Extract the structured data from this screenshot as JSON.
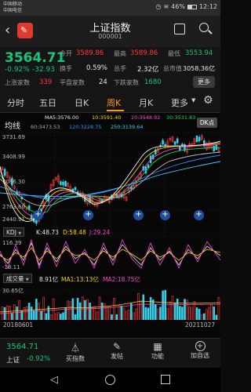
{
  "status_bar": {
    "carrier1": "中国移动",
    "carrier2": "中国电信",
    "battery": "46%",
    "time": "12:12"
  },
  "header": {
    "title": "上证指数",
    "code": "000001"
  },
  "quote": {
    "price": "3564.71",
    "change": "-0.92%",
    "change_amt": "-32.93",
    "open_label": "今开",
    "open": "3589.86",
    "high_label": "最高",
    "high": "3589.86",
    "low_label": "最低",
    "low": "3553.94",
    "turnover_label": "换手",
    "turnover": "0.59%",
    "amount_label": "总手",
    "amount": "2.32亿",
    "mcap_label": "总市值",
    "mcap": "3058.36亿",
    "up_label": "上涨家数",
    "up": "339",
    "flat_label": "平盘家数",
    "flat": "24",
    "down_label": "下跌家数",
    "down": "1680",
    "more": "更多"
  },
  "tabs": {
    "t1": "分时",
    "t2": "五日",
    "t3": "日K",
    "t4": "周K",
    "t5": "月K",
    "t6": "更多"
  },
  "chart_header": {
    "title": "均线",
    "dk": "DK点",
    "ma5": "MA5:3576.00",
    "ma10": "10:3591.40",
    "ma20": "20:3548.92",
    "ma30": "30:3531.83",
    "ma60": "60:3473.53",
    "ma120": "120:3228.75",
    "ma250": "250:3139.64"
  },
  "price_axis": {
    "p1": "3731.69",
    "p2": "3408.99",
    "p3": "3086.30",
    "p4": "2763.60",
    "p5": "2440.91"
  },
  "kdj": {
    "name": "KDJ",
    "k": "K:48.73",
    "d": "D:58.48",
    "j": "J:29.24",
    "top": "116.39",
    "bottom": "-18.11"
  },
  "vol": {
    "name": "成交量",
    "cur": "8.91亿",
    "ma1": "MA1:13.13亿",
    "ma2": "MA2:18.75亿",
    "top": "30.65亿"
  },
  "date_axis": {
    "start": "20180601",
    "end": "20211027"
  },
  "bottom_bar": {
    "price": "3564.71",
    "name": "上证",
    "change": "-0.92%",
    "b1": "买指数",
    "b2": "发帖",
    "b3": "功能",
    "b4": "加自选"
  },
  "colors": {
    "up": "#ff3b3b",
    "down": "#18c37a",
    "accent": "#ff9a1a"
  }
}
